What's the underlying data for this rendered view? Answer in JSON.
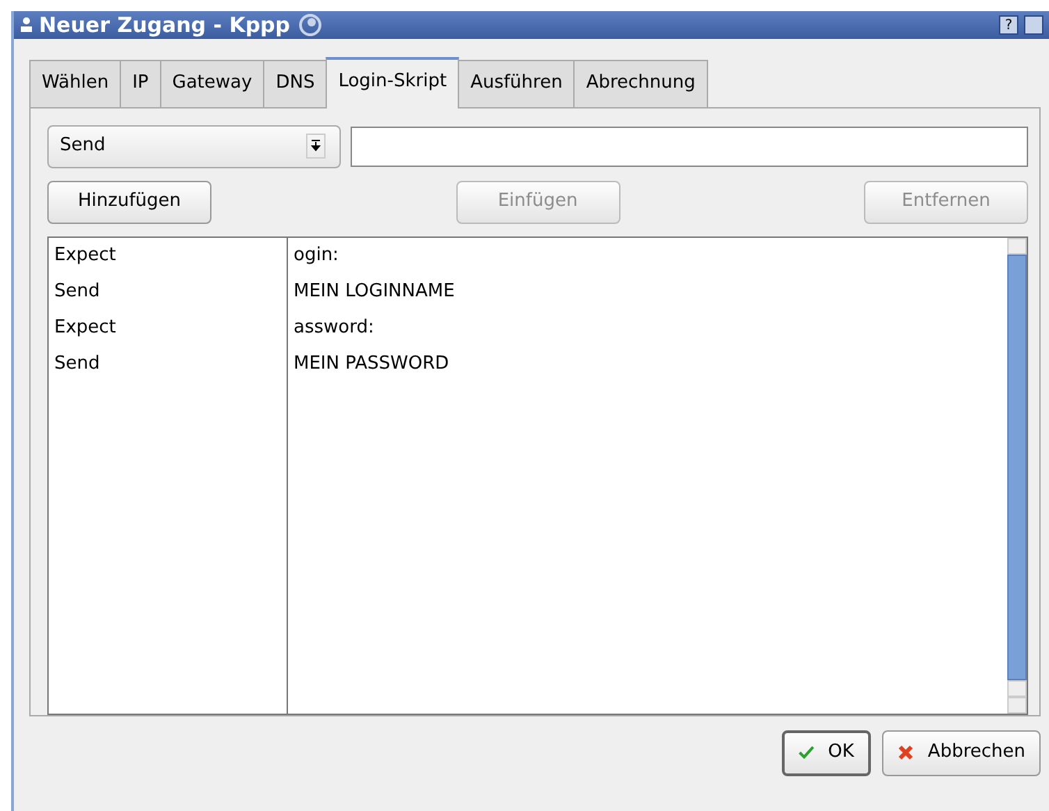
{
  "window": {
    "title": "Neuer Zugang - Kppp",
    "buttons": [
      "?"
    ]
  },
  "tabs": [
    {
      "label": "Wählen",
      "selected": false
    },
    {
      "label": "IP",
      "selected": false
    },
    {
      "label": "Gateway",
      "selected": false
    },
    {
      "label": "DNS",
      "selected": false
    },
    {
      "label": "Login-Skript",
      "selected": true
    },
    {
      "label": "Ausführen",
      "selected": false
    },
    {
      "label": "Abrechnung",
      "selected": false
    }
  ],
  "command": {
    "value": "Send"
  },
  "actions": [
    {
      "label": "Hinzufügen",
      "disabled": false
    },
    {
      "label": "Einfügen",
      "disabled": true
    },
    {
      "label": "Entfernen",
      "disabled": true
    }
  ],
  "script_rows": [
    {
      "command": "Expect",
      "argument": "ogin:"
    },
    {
      "command": "Send",
      "argument": "MEIN LOGINNAME"
    },
    {
      "command": "Expect",
      "argument": "assword:"
    },
    {
      "command": "Send",
      "argument": "MEIN PASSWORD"
    }
  ],
  "dialog_buttons": [
    {
      "label": "OK",
      "kind": "ok"
    },
    {
      "label": "Abbrechen",
      "kind": "cancel"
    }
  ]
}
